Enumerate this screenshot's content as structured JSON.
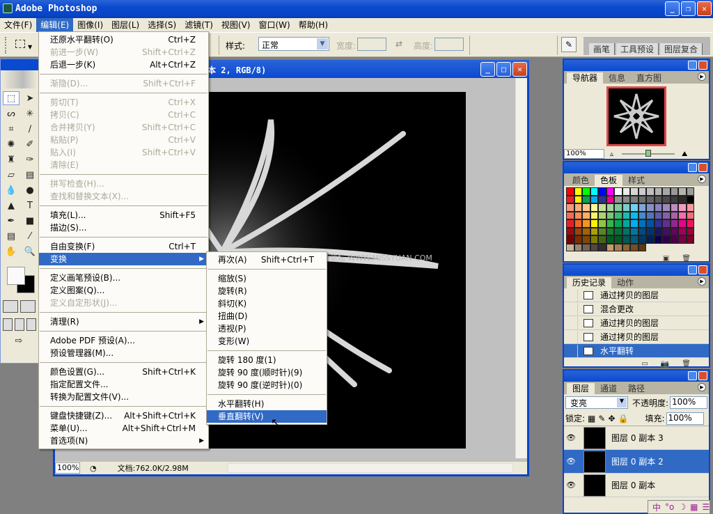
{
  "app": {
    "title": "Adobe Photoshop",
    "min": "_",
    "restore": "❐",
    "close": "✕"
  },
  "menubar": [
    "文件(F)",
    "编辑(E)",
    "图像(I)",
    "图层(L)",
    "选择(S)",
    "滤镜(T)",
    "视图(V)",
    "窗口(W)",
    "帮助(H)"
  ],
  "options": {
    "style_label": "样式:",
    "style_value": "正常",
    "width_label": "宽度:",
    "height_label": "高度:",
    "wells": [
      "画笔",
      "工具预设",
      "图层复合"
    ]
  },
  "edit_menu": [
    {
      "label": "还原水平翻转(O)",
      "shortcut": "Ctrl+Z"
    },
    {
      "label": "前进一步(W)",
      "shortcut": "Shift+Ctrl+Z",
      "disabled": true
    },
    {
      "label": "后退一步(K)",
      "shortcut": "Alt+Ctrl+Z"
    },
    {
      "sep": true
    },
    {
      "label": "渐隐(D)...",
      "shortcut": "Shift+Ctrl+F",
      "disabled": true
    },
    {
      "sep": true
    },
    {
      "label": "剪切(T)",
      "shortcut": "Ctrl+X",
      "disabled": true
    },
    {
      "label": "拷贝(C)",
      "shortcut": "Ctrl+C",
      "disabled": true
    },
    {
      "label": "合并拷贝(Y)",
      "shortcut": "Shift+Ctrl+C",
      "disabled": true
    },
    {
      "label": "粘贴(P)",
      "shortcut": "Ctrl+V",
      "disabled": true
    },
    {
      "label": "贴入(I)",
      "shortcut": "Shift+Ctrl+V",
      "disabled": true
    },
    {
      "label": "清除(E)",
      "shortcut": "",
      "disabled": true
    },
    {
      "sep": true
    },
    {
      "label": "拼写检查(H)...",
      "shortcut": "",
      "disabled": true
    },
    {
      "label": "查找和替换文本(X)...",
      "shortcut": "",
      "disabled": true
    },
    {
      "sep": true
    },
    {
      "label": "填充(L)...",
      "shortcut": "Shift+F5"
    },
    {
      "label": "描边(S)...",
      "shortcut": ""
    },
    {
      "sep": true
    },
    {
      "label": "自由变换(F)",
      "shortcut": "Ctrl+T"
    },
    {
      "label": "变换",
      "shortcut": "",
      "submenu": true,
      "highlight": true
    },
    {
      "sep": true
    },
    {
      "label": "定义画笔预设(B)...",
      "shortcut": ""
    },
    {
      "label": "定义图案(Q)...",
      "shortcut": ""
    },
    {
      "label": "定义自定形状(J)...",
      "shortcut": "",
      "disabled": true
    },
    {
      "sep": true
    },
    {
      "label": "清理(R)",
      "shortcut": "",
      "submenu": true
    },
    {
      "sep": true
    },
    {
      "label": "Adobe PDF 预设(A)...",
      "shortcut": ""
    },
    {
      "label": "预设管理器(M)...",
      "shortcut": ""
    },
    {
      "sep": true
    },
    {
      "label": "颜色设置(G)...",
      "shortcut": "Shift+Ctrl+K"
    },
    {
      "label": "指定配置文件...",
      "shortcut": ""
    },
    {
      "label": "转换为配置文件(V)...",
      "shortcut": ""
    },
    {
      "sep": true
    },
    {
      "label": "键盘快捷键(Z)...",
      "shortcut": "Alt+Shift+Ctrl+K"
    },
    {
      "label": "菜单(U)...",
      "shortcut": "Alt+Shift+Ctrl+M"
    },
    {
      "label": "首选项(N)",
      "shortcut": "",
      "submenu": true
    }
  ],
  "transform_menu": [
    {
      "label": "再次(A)",
      "shortcut": "Shift+Ctrl+T"
    },
    {
      "sep": true
    },
    {
      "label": "缩放(S)"
    },
    {
      "label": "旋转(R)"
    },
    {
      "label": "斜切(K)"
    },
    {
      "label": "扭曲(D)"
    },
    {
      "label": "透视(P)"
    },
    {
      "label": "变形(W)"
    },
    {
      "sep": true
    },
    {
      "label": "旋转 180 度(1)"
    },
    {
      "label": "旋转 90 度(顺时针)(9)"
    },
    {
      "label": "旋转 90 度(逆时针)(0)"
    },
    {
      "sep": true
    },
    {
      "label": "水平翻转(H)"
    },
    {
      "label": "垂直翻转(V)",
      "highlight": true
    }
  ],
  "document": {
    "title": "本 2, RGB/8)",
    "zoom": "100%",
    "info": "文档:762.0K/2.98M",
    "watermark": "思缘设计论坛 WWW.MISSYUAN.COM"
  },
  "navigator": {
    "tabs": [
      "导航器",
      "信息",
      "直方图"
    ],
    "zoom": "100%",
    "slider_fraction": 0.5
  },
  "swatches": {
    "tabs": [
      "颜色",
      "色板",
      "样式"
    ],
    "colors": [
      "#ff0000",
      "#ffff00",
      "#00ff00",
      "#00ffff",
      "#0000ff",
      "#ff00ff",
      "#ffffff",
      "#ebebeb",
      "#d6d6d6",
      "#cccccc",
      "#c0c0c0",
      "#b3b3b3",
      "#a6a6a6",
      "#999999",
      "#b4b4a8",
      "#9a9a9a",
      "#ed1c24",
      "#fff200",
      "#00a651",
      "#00aeef",
      "#2e3192",
      "#ec008c",
      "#959595",
      "#8a8a8a",
      "#7d7d7d",
      "#707070",
      "#646464",
      "#585858",
      "#4b4b4b",
      "#3e3e3e",
      "#2b2b2b",
      "#000000",
      "#f7977a",
      "#f9ad81",
      "#fdc68a",
      "#fff79a",
      "#c4df9b",
      "#a3d39c",
      "#82ca9d",
      "#7bcdc8",
      "#6ecff6",
      "#7ea7d8",
      "#8493ca",
      "#8882be",
      "#a187be",
      "#bc8dbf",
      "#f49ac2",
      "#f6989d",
      "#f26c4f",
      "#f68e55",
      "#fbaf5c",
      "#fff467",
      "#acd372",
      "#7cc576",
      "#3bb878",
      "#1abbb4",
      "#00bff3",
      "#438cca",
      "#5574b9",
      "#605ca8",
      "#855fa8",
      "#a763a8",
      "#f06ea9",
      "#f26d7d",
      "#ed1c24",
      "#f26522",
      "#f7941d",
      "#fff200",
      "#8dc73f",
      "#39b54a",
      "#00a651",
      "#00a99d",
      "#00aeef",
      "#0072bc",
      "#0054a6",
      "#2e3192",
      "#662d91",
      "#92278f",
      "#ec008c",
      "#ed145b",
      "#9e0b0f",
      "#a0410d",
      "#a36209",
      "#aba000",
      "#598527",
      "#197b30",
      "#007236",
      "#00746b",
      "#0076a3",
      "#004b80",
      "#003471",
      "#1b1464",
      "#440e62",
      "#630460",
      "#9e005d",
      "#9e0039",
      "#790000",
      "#7b2e00",
      "#7d4900",
      "#827b00",
      "#406618",
      "#005e20",
      "#005826",
      "#005952",
      "#005b7f",
      "#003663",
      "#002157",
      "#0d004c",
      "#32004b",
      "#4b0049",
      "#7b0046",
      "#7a0026",
      "#c7b299",
      "#998675",
      "#736357",
      "#534741",
      "#362f2d",
      "#c69c6d",
      "#a67c52",
      "#8c6239",
      "#754c24",
      "#603913"
    ]
  },
  "history": {
    "tabs": [
      "历史记录",
      "动作"
    ],
    "items": [
      {
        "label": "通过拷贝的图层"
      },
      {
        "label": "混合更改"
      },
      {
        "label": "通过拷贝的图层"
      },
      {
        "label": "通过拷贝的图层"
      },
      {
        "label": "水平翻转",
        "active": true
      }
    ]
  },
  "layers": {
    "tabs": [
      "图层",
      "通道",
      "路径"
    ],
    "blend_mode": "变亮",
    "opacity_label": "不透明度:",
    "opacity": "100%",
    "lock_label": "锁定:",
    "fill_label": "填充:",
    "fill": "100%",
    "items": [
      {
        "name": "图层 0 副本 3"
      },
      {
        "name": "图层 0 副本 2",
        "active": true
      },
      {
        "name": "图层 0 副本"
      }
    ]
  },
  "ime": [
    "中",
    "°o",
    "☽",
    "▦",
    "☰"
  ]
}
